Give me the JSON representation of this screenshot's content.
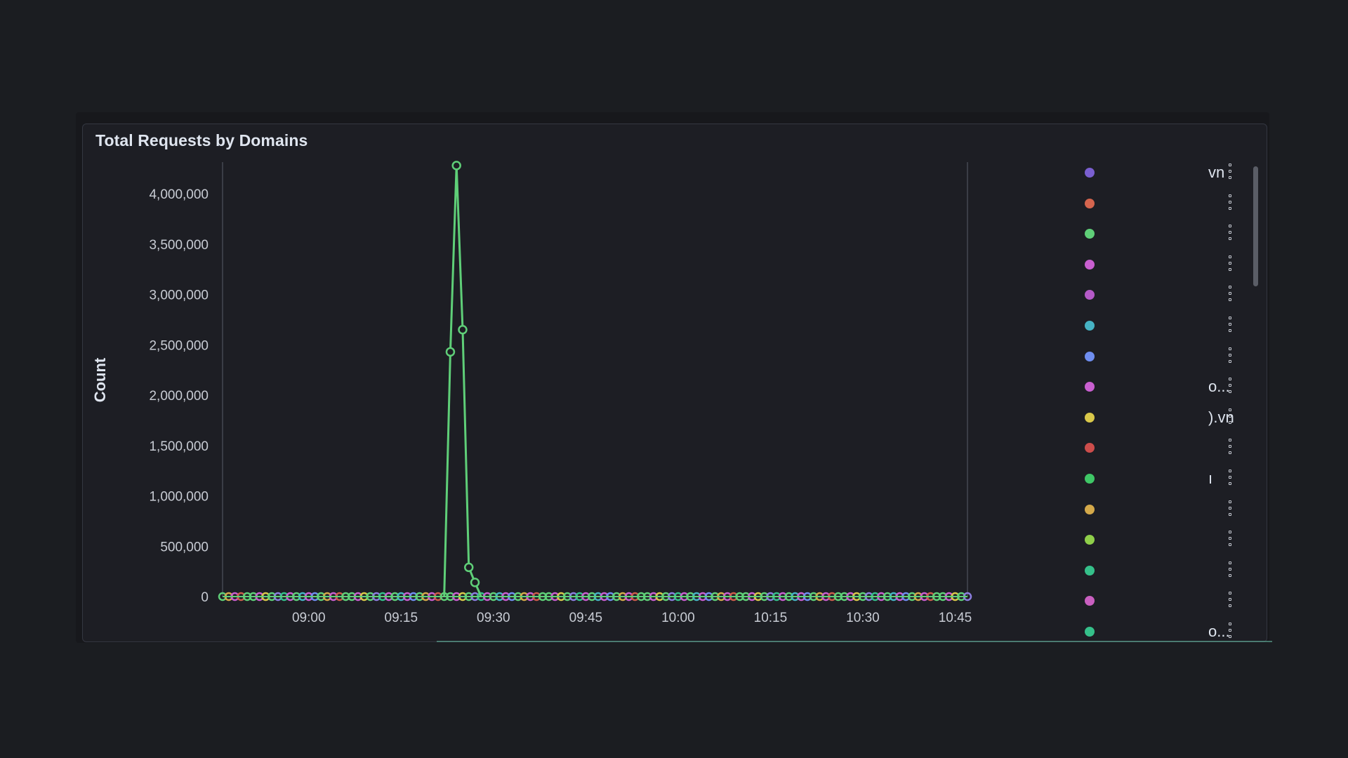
{
  "panel": {
    "title": "Total Requests by Domains"
  },
  "chart_data": {
    "type": "line",
    "title": "Total Requests by Domains",
    "xlabel": "",
    "ylabel": "Count",
    "ylim": [
      0,
      4300000
    ],
    "yticks": [
      0,
      500000,
      1000000,
      1500000,
      2000000,
      2500000,
      3000000,
      3500000,
      4000000
    ],
    "ytick_labels": [
      "0",
      "500,000",
      "1,000,000",
      "1,500,000",
      "2,000,000",
      "2,500,000",
      "3,000,000",
      "3,500,000",
      "4,000,000"
    ],
    "xlim": [
      "08:46",
      "10:47"
    ],
    "xticks": [
      "09:00",
      "09:15",
      "09:30",
      "09:45",
      "10:00",
      "10:15",
      "10:30",
      "10:45"
    ],
    "grid": false,
    "legend": "right",
    "series": [
      {
        "color": "#5fcf78",
        "points": [
          [
            "09:22",
            0
          ],
          [
            "09:23",
            2430000
          ],
          [
            "09:24",
            4280000
          ],
          [
            "09:25",
            2650000
          ],
          [
            "09:26",
            290000
          ],
          [
            "09:27",
            140000
          ],
          [
            "09:28",
            0
          ]
        ]
      }
    ],
    "baseline_colors": [
      "#5fcf78",
      "#d4a94a",
      "#c95fd0",
      "#cc5d4b",
      "#5fcf78",
      "#5fcf78",
      "#c95fd0",
      "#d9c84a",
      "#5fcf78",
      "#8c7ee0",
      "#35c08a",
      "#c95fd0",
      "#5fcf78",
      "#46b3c4",
      "#c95fd0",
      "#6f8ef0"
    ]
  },
  "legend": {
    "items": [
      {
        "color": "#7a5fd0",
        "label": "vn"
      },
      {
        "color": "#d5654e",
        "label": ""
      },
      {
        "color": "#5fcf78",
        "label": ""
      },
      {
        "color": "#c95fd0",
        "label": ""
      },
      {
        "color": "#b55ac8",
        "label": ""
      },
      {
        "color": "#46b3c4",
        "label": ""
      },
      {
        "color": "#6f8ef0",
        "label": ""
      },
      {
        "color": "#c95fd0",
        "label": "o..."
      },
      {
        "color": "#d9c84a",
        "label": ").vn"
      },
      {
        "color": "#cc4d4b",
        "label": ""
      },
      {
        "color": "#3fc766",
        "label": "ı"
      },
      {
        "color": "#d4a94a",
        "label": ""
      },
      {
        "color": "#8fcf4a",
        "label": ""
      },
      {
        "color": "#35c08a",
        "label": ""
      },
      {
        "color": "#c95fc0",
        "label": ""
      },
      {
        "color": "#35c08a",
        "label": "o..."
      }
    ]
  }
}
